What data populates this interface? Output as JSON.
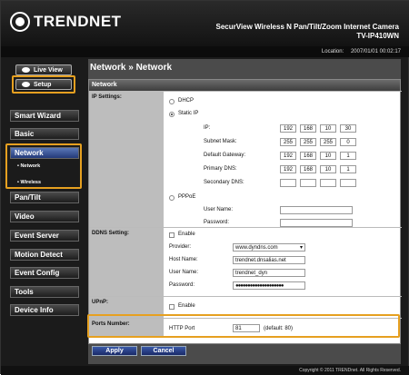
{
  "brand": {
    "name": "TRENDNET"
  },
  "header": {
    "product": "SecurView Wireless N Pan/Tilt/Zoom Internet Camera",
    "model": "TV-IP410WN"
  },
  "location": {
    "label": "Location:",
    "datetime": "2007/01/01 00:02:17"
  },
  "sidebar": {
    "live_view": "Live View",
    "setup": "Setup",
    "items": [
      "Smart Wizard",
      "Basic",
      "Network",
      "Pan/Tilt",
      "Video",
      "Event Server",
      "Motion Detect",
      "Event Config",
      "Tools",
      "Device Info"
    ],
    "sub_items": [
      "• Network",
      "• Wireless"
    ]
  },
  "page": {
    "breadcrumb": "Network » Network",
    "panel_title": "Network"
  },
  "ip_settings": {
    "label": "IP Settings:",
    "dhcp": "DHCP",
    "static_ip": "Static IP",
    "fields": [
      {
        "label": "IP:",
        "value": [
          "192",
          "168",
          "10",
          "30"
        ]
      },
      {
        "label": "Subnet Mask:",
        "value": [
          "255",
          "255",
          "255",
          "0"
        ]
      },
      {
        "label": "Default Gateway:",
        "value": [
          "192",
          "168",
          "10",
          "1"
        ]
      },
      {
        "label": "Primary DNS:",
        "value": [
          "192",
          "168",
          "10",
          "1"
        ]
      },
      {
        "label": "Secondary DNS:",
        "value": [
          "",
          "",
          "",
          ""
        ]
      }
    ],
    "pppoe": "PPPoE",
    "user_name_label": "User Name:",
    "password_label": "Password:"
  },
  "ddns": {
    "label": "DDNS Setting:",
    "enable": "Enable",
    "provider_label": "Provider:",
    "provider_value": "www.dyndns.com",
    "host_label": "Host Name:",
    "host_value": "trendnet.dnsalias.net",
    "user_label": "User Name:",
    "user_value": "trendnet_dyn",
    "password_label": "Password:",
    "password_value": "●●●●●●●●●●●●●●●●●●●●"
  },
  "upnp": {
    "label": "UPnP:",
    "enable": "Enable"
  },
  "ports": {
    "label": "Ports Number:",
    "http_label": "HTTP Port",
    "http_value": "81",
    "default_note": "(default: 80)"
  },
  "buttons": {
    "apply": "Apply",
    "cancel": "Cancel"
  },
  "footer": {
    "copyright": "Copyright © 2011 TRENDnet. All Rights Reserved."
  },
  "colors": {
    "highlight": "#e6a020",
    "active_menu": "#3a5aa8"
  }
}
